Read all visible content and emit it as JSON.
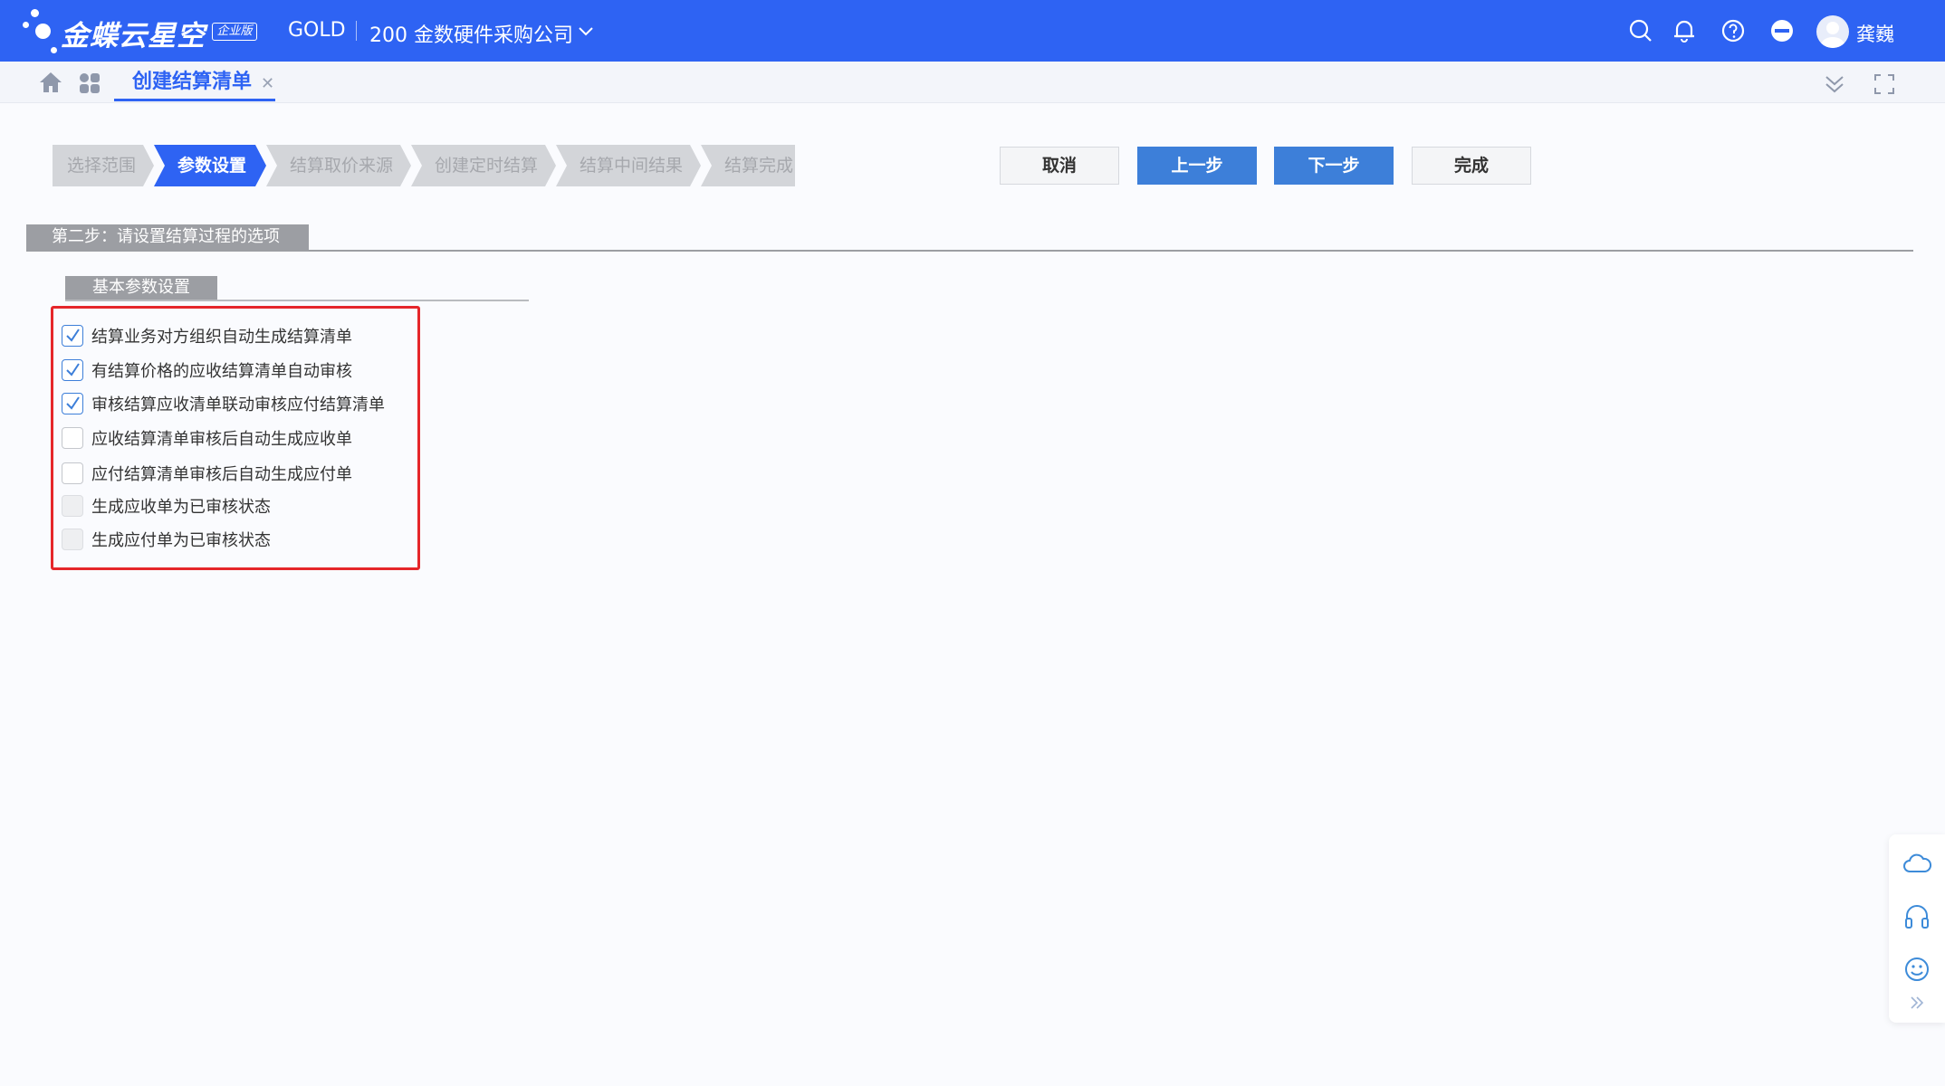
{
  "header": {
    "brand": "金蝶云星空",
    "edition": "企业版",
    "tenant": "GOLD",
    "company": "200 金数硬件采购公司",
    "user_name": "龚巍",
    "icons": [
      "search-icon",
      "bell-icon",
      "help-icon",
      "minus-circle-icon",
      "avatar"
    ]
  },
  "tabs": [
    {
      "label": "创建结算清单",
      "active": true
    }
  ],
  "stepper": {
    "steps": [
      {
        "label": "选择范围",
        "active": false
      },
      {
        "label": "参数设置",
        "active": true
      },
      {
        "label": "结算取价来源",
        "active": false
      },
      {
        "label": "创建定时结算",
        "active": false
      },
      {
        "label": "结算中间结果",
        "active": false
      },
      {
        "label": "结算完成",
        "active": false
      }
    ]
  },
  "actions": {
    "cancel": "取消",
    "prev": "上一步",
    "next": "下一步",
    "finish": "完成"
  },
  "section": {
    "title": "第二步：请设置结算过程的选项",
    "group_title": "基本参数设置"
  },
  "options": [
    {
      "label": "结算业务对方组织自动生成结算清单",
      "checked": true,
      "disabled": false
    },
    {
      "label": "有结算价格的应收结算清单自动审核",
      "checked": true,
      "disabled": false
    },
    {
      "label": "审核结算应收清单联动审核应付结算清单",
      "checked": true,
      "disabled": false
    },
    {
      "label": "应收结算清单审核后自动生成应收单",
      "checked": false,
      "disabled": false
    },
    {
      "label": "应付结算清单审核后自动生成应付单",
      "checked": false,
      "disabled": false
    },
    {
      "label": "生成应收单为已审核状态",
      "checked": false,
      "disabled": true
    },
    {
      "label": "生成应付单为已审核状态",
      "checked": false,
      "disabled": true
    }
  ],
  "colors": {
    "primary": "#2e63f3",
    "button_primary": "#3d7fd9",
    "highlight": "#e5262a",
    "step_inactive": "#d3d5d9"
  }
}
